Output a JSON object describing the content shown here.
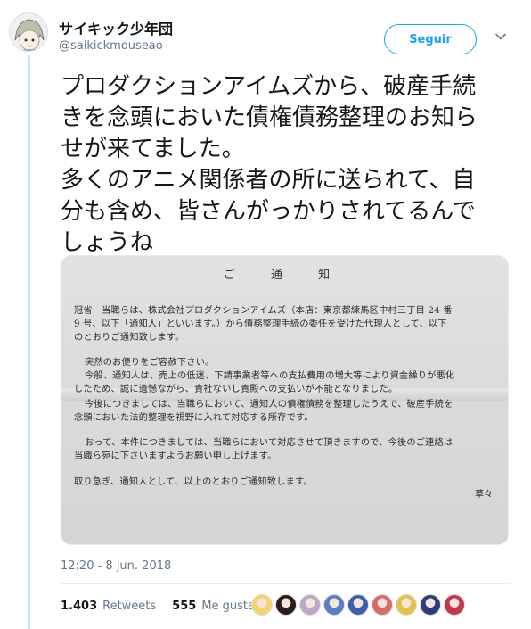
{
  "tweet": {
    "display_name": "サイキック少年団",
    "handle": "@saikickmouseao",
    "follow_label": "Seguir",
    "text_lines": [
      "プロダクションアイムズから、破産手続",
      "きを念頭においた債権債務整理のお知ら",
      "せが来てました。",
      "多くのアニメ関係者の所に送られて、自",
      "分も含め、皆さんがっかりされてるんで",
      "しょうね"
    ],
    "timestamp": "12:20 - 8 jun. 2018",
    "retweets_count": "1.403",
    "retweets_label": "Retweets",
    "likes_count": "555",
    "likes_label": "Me gusta"
  },
  "photo": {
    "title": "ご 通 知",
    "lines": [
      "冠省　当職らは、株式会社プロダクションアイムズ（本店：東京都練馬区中村三丁目 24 番",
      "9 号、以下「通知人」といいます。）から債務整理手続の委任を受けた代理人として、以下",
      "のとおりご通知致します。",
      "突然のお便りをご容赦下さい。",
      "今般、通知人は、売上の低迷、下請事業者等への支払費用の増大等により資金繰りが悪化",
      "したため、誠に遺憾ながら、貴社ないし貴殿への支払いが不能となりました。",
      "今後につきましては、当職らにおいて、通知人の債権債務を整理したうえで、破産手続を",
      "念頭においた法的整理を視野に入れて対応する所存です。",
      "おって、本件につきましては、当職らにおいて対応させて頂きますので、今後のご連絡は",
      "当職ら宛に下さいますようお願い申し上げます。",
      "取り急ぎ、通知人として、以上のとおりご通知致します。"
    ],
    "closing": "草々"
  },
  "colors": {
    "accent": "#1da1f2",
    "thread_line": "#cce4f6",
    "secondary_text": "#657786"
  },
  "icons": {
    "menu": "chevron-down-icon",
    "avatar": "anime-character-avatar"
  },
  "likers": [
    "#f2d56b",
    "#2b1d1d",
    "#b9a9c9",
    "#5a7fc4",
    "#3a5fb0",
    "#d96a6a",
    "#e2c24a",
    "#2c3e7a",
    "#c2374d"
  ]
}
